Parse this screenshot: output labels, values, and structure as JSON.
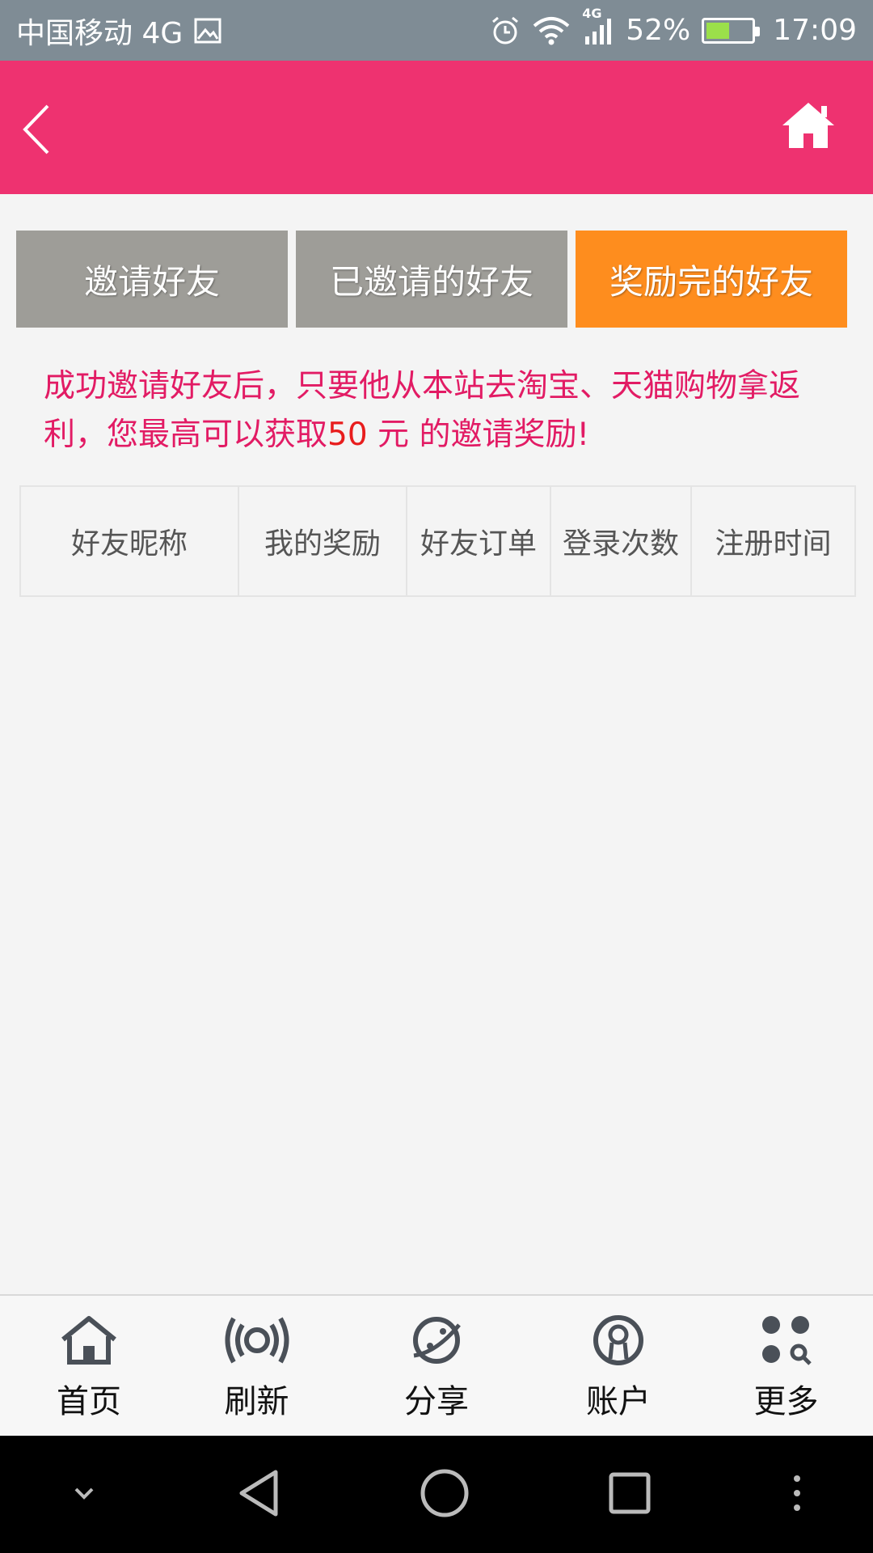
{
  "status_bar": {
    "carrier": "中国移动 4G",
    "network_badge": "4G",
    "battery": "52%",
    "battery_level": 0.52,
    "time": "17:09",
    "icons": [
      "image-icon",
      "alarm-icon",
      "wifi-icon",
      "signal-icon",
      "battery-icon"
    ]
  },
  "header": {
    "back_icon": "chevron-left-icon",
    "home_icon": "home-icon"
  },
  "tabs": [
    {
      "label": "邀请好友",
      "active": false
    },
    {
      "label": "已邀请的好友",
      "active": false
    },
    {
      "label": "奖励完的好友",
      "active": true
    }
  ],
  "notice": {
    "text_before": "成功邀请好友后，只要他从本站去淘宝、天猫购物拿返利，您最高可以获取",
    "amount": "50",
    "text_after": " 元 的邀请奖励!"
  },
  "table": {
    "columns": [
      "好友昵称",
      "我的奖励",
      "好友订单",
      "登录次数",
      "注册时间"
    ]
  },
  "bottom_nav": [
    {
      "label": "首页",
      "icon": "home-outline-icon"
    },
    {
      "label": "刷新",
      "icon": "broadcast-icon"
    },
    {
      "label": "分享",
      "icon": "planet-icon"
    },
    {
      "label": "账户",
      "icon": "account-icon"
    },
    {
      "label": "更多",
      "icon": "more-grid-icon"
    }
  ],
  "system_nav": [
    "collapse-icon",
    "back-triangle-icon",
    "home-circle-icon",
    "recents-square-icon",
    "menu-dots-icon"
  ],
  "colors": {
    "header": "#ee3270",
    "tab_inactive": "#9e9d98",
    "tab_active": "#fe8d1e",
    "notice_text": "#e21b64",
    "notice_amount": "#e81d1d"
  }
}
